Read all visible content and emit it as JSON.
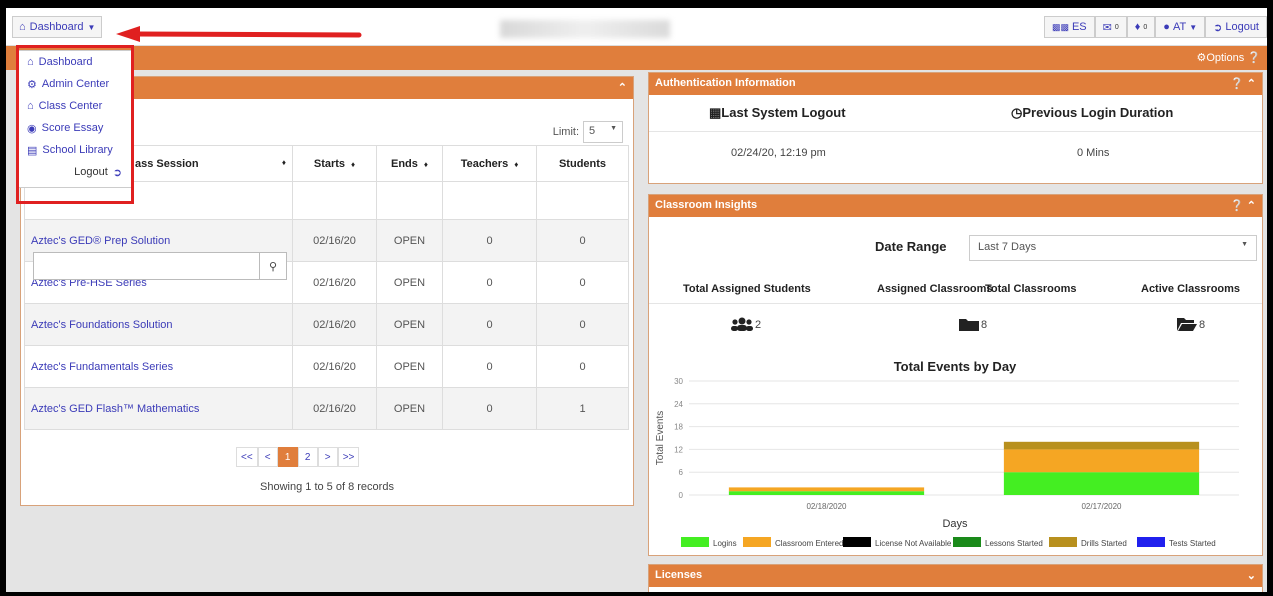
{
  "topbar": {
    "dashboard_label": "Dashboard",
    "lang": "ES",
    "mail_count": "0",
    "bell_count": "0",
    "user": "AT",
    "logout": "Logout"
  },
  "subbar": {
    "options": "Options"
  },
  "menu": {
    "items": [
      {
        "label": "Dashboard",
        "icon": "home-icon"
      },
      {
        "label": "Admin Center",
        "icon": "gear-icon"
      },
      {
        "label": "Class Center",
        "icon": "institution-icon"
      },
      {
        "label": "Score Essay",
        "icon": "globe-icon"
      },
      {
        "label": "School Library",
        "icon": "book-icon"
      }
    ],
    "logout": "Logout"
  },
  "classes": {
    "limit_label": "Limit:",
    "limit_value": "5",
    "columns": [
      "ass Session",
      "Starts",
      "Ends",
      "Teachers",
      "Students"
    ],
    "rows": [
      {
        "name": "Aztec's GED® Prep Solution",
        "starts": "02/16/20",
        "ends": "OPEN",
        "teachers": "0",
        "students": "0"
      },
      {
        "name": "Aztec's Pre-HSE Series",
        "starts": "02/16/20",
        "ends": "OPEN",
        "teachers": "0",
        "students": "0"
      },
      {
        "name": "Aztec's Foundations Solution",
        "starts": "02/16/20",
        "ends": "OPEN",
        "teachers": "0",
        "students": "0"
      },
      {
        "name": "Aztec's Fundamentals Series",
        "starts": "02/16/20",
        "ends": "OPEN",
        "teachers": "0",
        "students": "0"
      },
      {
        "name": "Aztec's GED Flash™ Mathematics",
        "starts": "02/16/20",
        "ends": "OPEN",
        "teachers": "0",
        "students": "1"
      }
    ],
    "pager": [
      "<<",
      "<",
      "1",
      "2",
      ">",
      ">>"
    ],
    "showing": "Showing 1 to 5 of 8 records"
  },
  "auth": {
    "title": "Authentication Information",
    "last_logout_label": "Last System Logout",
    "last_logout_value": "02/24/20, 12:19 pm",
    "prev_duration_label": "Previous Login Duration",
    "prev_duration_value": "0 Mins"
  },
  "insights": {
    "title": "Classroom Insights",
    "date_range_label": "Date Range",
    "date_range_value": "Last 7 Days",
    "stats": [
      {
        "label": "Total Assigned Students",
        "value": "2",
        "icon": "users-icon"
      },
      {
        "label": "Assigned Classrooms",
        "value": "8",
        "icon": "folder-icon"
      },
      {
        "label": "Total Classrooms",
        "value": "",
        "icon": ""
      },
      {
        "label": "Active Classrooms",
        "value": "8",
        "icon": "folder-open-icon"
      }
    ]
  },
  "licenses": {
    "title": "Licenses"
  },
  "colors": {
    "accent": "#e07e3c",
    "link": "#3b3bb8",
    "highlight": "#e02020"
  },
  "chart_data": {
    "type": "bar",
    "stacked": true,
    "title": "Total Events by Day",
    "xlabel": "Days",
    "ylabel": "Total Events",
    "categories": [
      "02/18/2020",
      "02/17/2020"
    ],
    "ylim": [
      0,
      30
    ],
    "yticks": [
      0,
      6,
      12,
      18,
      24,
      30
    ],
    "series": [
      {
        "name": "Logins",
        "color": "#44ee22",
        "values": [
          1,
          6
        ]
      },
      {
        "name": "Classroom Entered",
        "color": "#f5a623",
        "values": [
          1,
          6
        ]
      },
      {
        "name": "License Not Available",
        "color": "#000000",
        "values": [
          0,
          0
        ]
      },
      {
        "name": "Lessons Started",
        "color": "#1a8a1a",
        "values": [
          0,
          0
        ]
      },
      {
        "name": "Drills Started",
        "color": "#b8901e",
        "values": [
          0,
          2
        ]
      },
      {
        "name": "Tests Started",
        "color": "#2020ee",
        "values": [
          0,
          0
        ]
      }
    ],
    "grid": true,
    "legend": "bottom"
  }
}
